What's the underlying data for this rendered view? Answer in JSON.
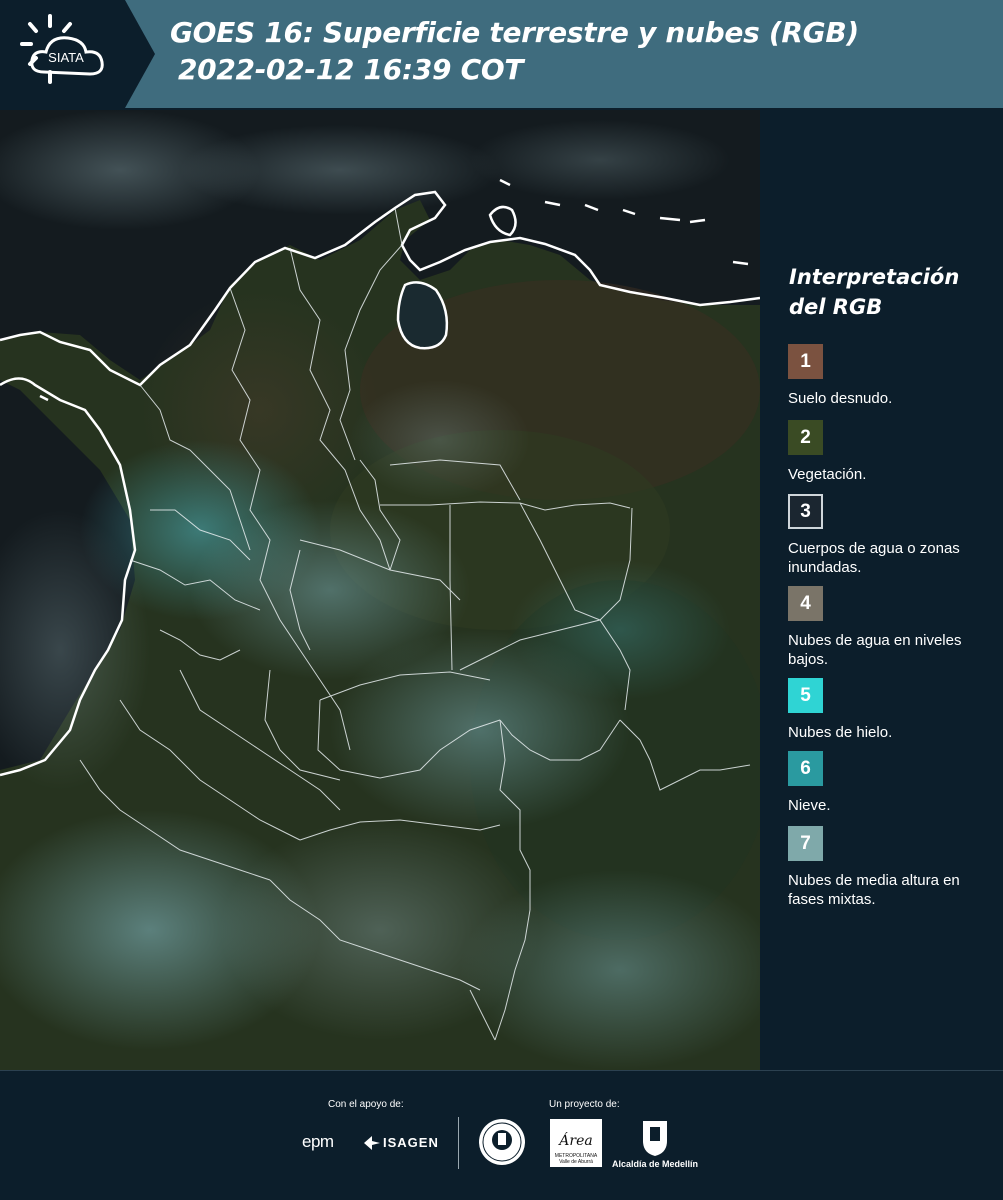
{
  "header": {
    "logo_text": "SIATA",
    "title_line1": "GOES 16: Superficie terrestre y nubes (RGB)",
    "title_line2": "2022-02-12 16:39 COT",
    "background_color": "#3f6c7e"
  },
  "map": {
    "description_icon": "satellite-rgb-map",
    "border_color": "#ffffff"
  },
  "legend": {
    "title_line1": "Interpretación",
    "title_line2": "del RGB",
    "items": [
      {
        "number": "1",
        "label": "Suelo desnudo.",
        "color": "#7b5240"
      },
      {
        "number": "2",
        "label": "Vegetación.",
        "color": "#3a4b24"
      },
      {
        "number": "3",
        "label": "Cuerpos de agua o zonas inundadas.",
        "color": "#1b2630"
      },
      {
        "number": "4",
        "label": "Nubes de agua en niveles bajos.",
        "color": "#7a7468"
      },
      {
        "number": "5",
        "label": "Nubes de hielo.",
        "color": "#2fd4d4"
      },
      {
        "number": "6",
        "label": "Nieve.",
        "color": "#2a9aa0"
      },
      {
        "number": "7",
        "label": "Nubes de media altura en fases mixtas.",
        "color": "#7fa9aa"
      }
    ]
  },
  "footer": {
    "support_label": "Con el apoyo de:",
    "project_label": "Un proyecto de:",
    "sponsor1": "epm",
    "sponsor2": "ISAGEN",
    "area_name": "Área",
    "area_sub": "METROPOLITANA Valle de Aburrá",
    "alcaldia": "Alcaldía de Medellín"
  }
}
